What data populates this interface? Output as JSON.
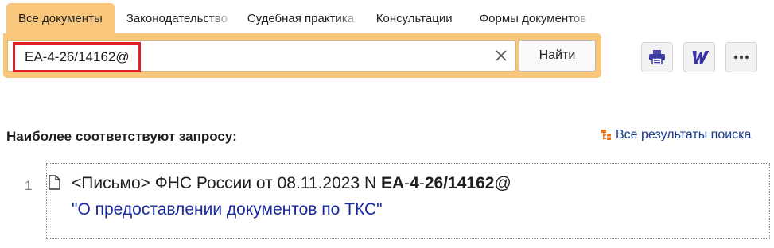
{
  "tabs": [
    {
      "label": "Все документы"
    },
    {
      "label": "Законодательство"
    },
    {
      "label": "Судебная практика"
    },
    {
      "label": "Консультации"
    },
    {
      "label": "Формы документов"
    }
  ],
  "search": {
    "query": "ЕА-4-26/14162@",
    "find_label": "Найти"
  },
  "results": {
    "heading": "Наиболее соответствуют запросу:",
    "all_results_label": "Все результаты поиска",
    "items": [
      {
        "number": "1",
        "prefix": "<Письмо> ФНС России от 08.11.2023 N ",
        "hl_a": "ЕА",
        "sep1": "-",
        "hl_b": "4",
        "sep2": "-",
        "hl_c": "26/14162",
        "suffix": "@",
        "title": "\"О предоставлении документов по ТКС\""
      }
    ]
  },
  "colors": {
    "accent": "#f9c77c",
    "highlight_border": "#e01f26",
    "link": "#1a3a8f",
    "result_title": "#1a2a9e"
  },
  "icons": [
    "clear-icon",
    "printer-icon",
    "word-icon",
    "more-icon",
    "tree-icon",
    "document-icon"
  ]
}
